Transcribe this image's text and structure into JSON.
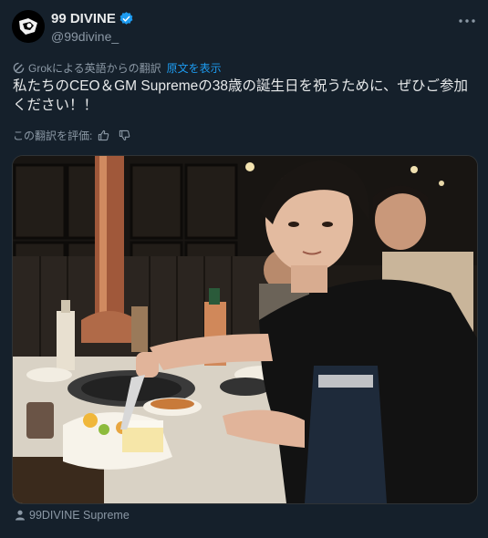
{
  "author": {
    "display_name": "99 DIVINE",
    "handle": "@99divine_",
    "verified": true
  },
  "translation": {
    "note": "Grokによる英語からの翻訳",
    "show_original": "原文を表示"
  },
  "tweet": {
    "text": "私たちのCEO＆GM Supremeの38歳の誕生日を祝うために、ぜひご参加ください！！"
  },
  "rating": {
    "label": "この翻訳を評価:"
  },
  "media": {
    "alt": "Man cutting a cake at a Korean BBQ restaurant table",
    "tag": "99DIVINE Supreme"
  },
  "colors": {
    "background": "#15202b",
    "accent": "#1d9bf0",
    "text": "#e7e9ea",
    "muted": "#8b98a5"
  },
  "icons": [
    "more-icon",
    "verified-badge-icon",
    "grok-icon",
    "thumbs-up-icon",
    "thumbs-down-icon",
    "person-icon"
  ]
}
